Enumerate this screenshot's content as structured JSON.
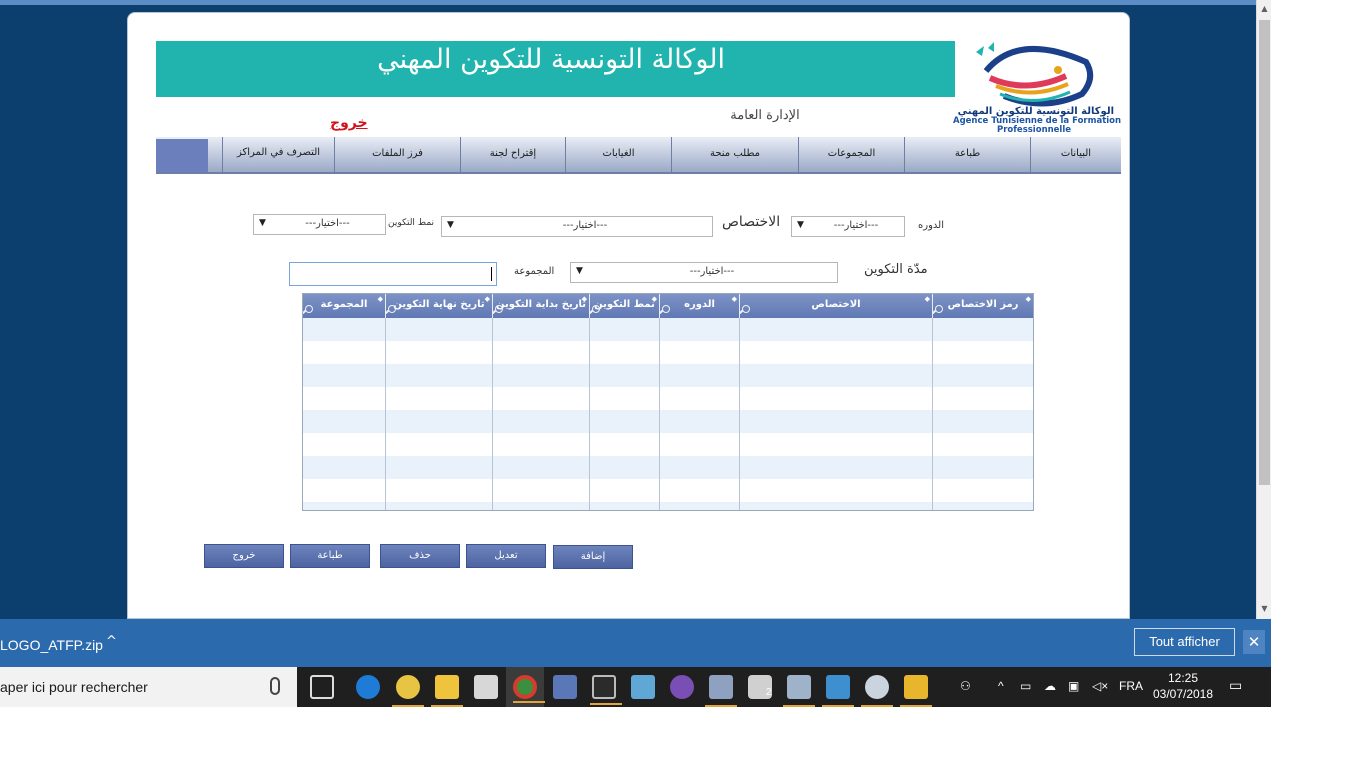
{
  "banner": {
    "title": "الوكالة التونسية للتكوين المهني"
  },
  "logo": {
    "arabic": "الوكالة التونسية للتكوين المهني",
    "french_line1": "Agence Tunisienne de la Formation",
    "french_line2": "Professionnelle"
  },
  "header": {
    "direction": "الإدارة العامة",
    "logout": "خروج"
  },
  "menu": {
    "items": [
      "البيانات",
      "طباعة",
      "المجموعات",
      "مطلب منحة",
      "الغيابات",
      "إقتراح لجنة",
      "فرز الملفات",
      "التصرف في المراكز"
    ]
  },
  "filters": {
    "session_label": "الدوره",
    "session_value": "---اختيار---",
    "specialty_label": "الاختصاص",
    "specialty_value": "---اختيار---",
    "mode_label": "نمط التكوين",
    "mode_value": "---اختيار---",
    "duration_label": "مدّة التكوين",
    "duration_value": "---اختيار---",
    "group_label": "المجموعة",
    "group_value": ""
  },
  "grid": {
    "columns": [
      "رمز الاختصاص",
      "الاختصاص",
      "الدوره",
      "نمط التكوين",
      "تاريخ بداية التكوين",
      "تاريخ نهاية التكوين",
      "المجموعة"
    ],
    "rows": []
  },
  "actions": {
    "add": "إضافة",
    "edit": "تعديل",
    "delete": "حذف",
    "print": "طباعة",
    "exit": "خروج"
  },
  "scrollbar": {
    "up": "▲",
    "down": "▼"
  },
  "downloads": {
    "file": "LOGO_ATFP.zip",
    "show_all": "Tout afficher",
    "chevron": "^",
    "close": "✕"
  },
  "taskbar": {
    "search_placeholder": "aper ici pour rechercher",
    "language": "FRA",
    "time": "12:25",
    "date": "03/07/2018",
    "mail_badge": "2"
  },
  "colors": {
    "banner": "#21b4ae",
    "menu_accent": "#6b7fbc",
    "grid_header": "#6b80bb",
    "logout": "#d4121e"
  }
}
